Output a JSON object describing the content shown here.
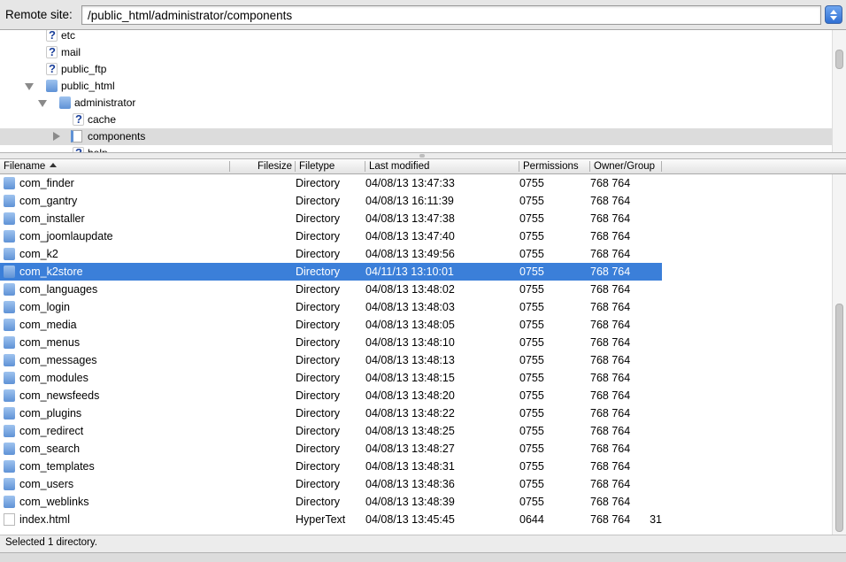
{
  "remote_site": {
    "label": "Remote site:",
    "path": "/public_html/administrator/components"
  },
  "tree": {
    "items": [
      {
        "label": "etc",
        "icon": "question-icon"
      },
      {
        "label": "mail",
        "icon": "question-icon"
      },
      {
        "label": "public_ftp",
        "icon": "question-icon"
      },
      {
        "label": "public_html",
        "icon": "folder-icon",
        "expanded": true
      },
      {
        "label": "administrator",
        "icon": "folder-icon",
        "expanded": true
      },
      {
        "label": "cache",
        "icon": "question-icon"
      },
      {
        "label": "components",
        "icon": "open-folder-icon",
        "selected": true
      },
      {
        "label": "help",
        "icon": "question-icon"
      }
    ]
  },
  "columns": {
    "filename": "Filename",
    "filesize": "Filesize",
    "filetype": "Filetype",
    "last_modified": "Last modified",
    "permissions": "Permissions",
    "owner_group": "Owner/Group"
  },
  "files": [
    {
      "name": "com_finder",
      "size": "",
      "type": "Directory",
      "modified": "04/08/13 13:47:33",
      "perm": "0755",
      "owner": "768 764"
    },
    {
      "name": "com_gantry",
      "size": "",
      "type": "Directory",
      "modified": "04/08/13 16:11:39",
      "perm": "0755",
      "owner": "768 764"
    },
    {
      "name": "com_installer",
      "size": "",
      "type": "Directory",
      "modified": "04/08/13 13:47:38",
      "perm": "0755",
      "owner": "768 764"
    },
    {
      "name": "com_joomlaupdate",
      "size": "",
      "type": "Directory",
      "modified": "04/08/13 13:47:40",
      "perm": "0755",
      "owner": "768 764"
    },
    {
      "name": "com_k2",
      "size": "",
      "type": "Directory",
      "modified": "04/08/13 13:49:56",
      "perm": "0755",
      "owner": "768 764"
    },
    {
      "name": "com_k2store",
      "size": "",
      "type": "Directory",
      "modified": "04/11/13 13:10:01",
      "perm": "0755",
      "owner": "768 764",
      "selected": true
    },
    {
      "name": "com_languages",
      "size": "",
      "type": "Directory",
      "modified": "04/08/13 13:48:02",
      "perm": "0755",
      "owner": "768 764"
    },
    {
      "name": "com_login",
      "size": "",
      "type": "Directory",
      "modified": "04/08/13 13:48:03",
      "perm": "0755",
      "owner": "768 764"
    },
    {
      "name": "com_media",
      "size": "",
      "type": "Directory",
      "modified": "04/08/13 13:48:05",
      "perm": "0755",
      "owner": "768 764"
    },
    {
      "name": "com_menus",
      "size": "",
      "type": "Directory",
      "modified": "04/08/13 13:48:10",
      "perm": "0755",
      "owner": "768 764"
    },
    {
      "name": "com_messages",
      "size": "",
      "type": "Directory",
      "modified": "04/08/13 13:48:13",
      "perm": "0755",
      "owner": "768 764"
    },
    {
      "name": "com_modules",
      "size": "",
      "type": "Directory",
      "modified": "04/08/13 13:48:15",
      "perm": "0755",
      "owner": "768 764"
    },
    {
      "name": "com_newsfeeds",
      "size": "",
      "type": "Directory",
      "modified": "04/08/13 13:48:20",
      "perm": "0755",
      "owner": "768 764"
    },
    {
      "name": "com_plugins",
      "size": "",
      "type": "Directory",
      "modified": "04/08/13 13:48:22",
      "perm": "0755",
      "owner": "768 764"
    },
    {
      "name": "com_redirect",
      "size": "",
      "type": "Directory",
      "modified": "04/08/13 13:48:25",
      "perm": "0755",
      "owner": "768 764"
    },
    {
      "name": "com_search",
      "size": "",
      "type": "Directory",
      "modified": "04/08/13 13:48:27",
      "perm": "0755",
      "owner": "768 764"
    },
    {
      "name": "com_templates",
      "size": "",
      "type": "Directory",
      "modified": "04/08/13 13:48:31",
      "perm": "0755",
      "owner": "768 764"
    },
    {
      "name": "com_users",
      "size": "",
      "type": "Directory",
      "modified": "04/08/13 13:48:36",
      "perm": "0755",
      "owner": "768 764"
    },
    {
      "name": "com_weblinks",
      "size": "",
      "type": "Directory",
      "modified": "04/08/13 13:48:39",
      "perm": "0755",
      "owner": "768 764"
    },
    {
      "name": "index.html",
      "size": "31",
      "type": "HyperText",
      "modified": "04/08/13 13:45:45",
      "perm": "0644",
      "owner": "768 764"
    }
  ],
  "status": "Selected 1 directory.",
  "colors": {
    "selection": "#3b7fd9",
    "tree_selection": "#dcdcdc",
    "folder": "#5f92d6"
  }
}
